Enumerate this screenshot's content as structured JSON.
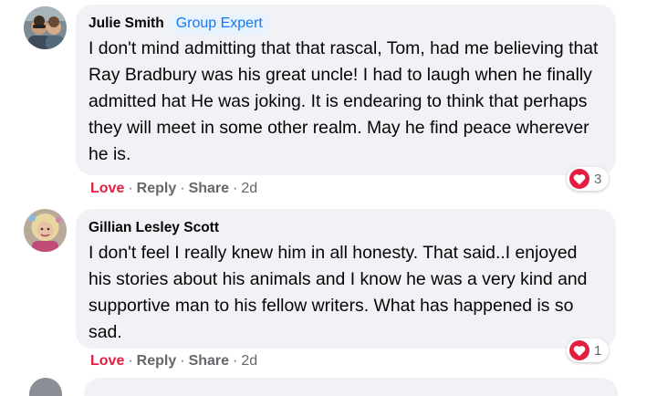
{
  "comments": [
    {
      "author": "Julie Smith",
      "badge": "Group Expert",
      "text": "I don't mind admitting that that rascal, Tom, had me believing that Ray Bradbury was his great uncle! I had to laugh when he finally admitted hat He was joking. It is endearing to think that perhaps they will meet in some other realm. May he find peace wherever he is.",
      "actions": {
        "love": "Love",
        "reply": "Reply",
        "share": "Share",
        "time": "2d",
        "separator": "·"
      },
      "reaction_icon": "heart-icon",
      "reaction_count": "3"
    },
    {
      "author": "Gillian Lesley Scott",
      "text": "I don't feel I really knew him in all honesty. That said..I enjoyed his stories about his animals and I know he was a very kind and supportive man to his fellow writers. What has happened is so sad.",
      "actions": {
        "love": "Love",
        "reply": "Reply",
        "share": "Share",
        "time": "2d",
        "separator": "·"
      },
      "reaction_icon": "heart-icon",
      "reaction_count": "1"
    }
  ],
  "colors": {
    "bubble": "#f0f2f5",
    "love": "#e41e3f",
    "meta": "#65676b",
    "badge_bg": "#e7f3ff",
    "badge_text": "#1877f2"
  }
}
